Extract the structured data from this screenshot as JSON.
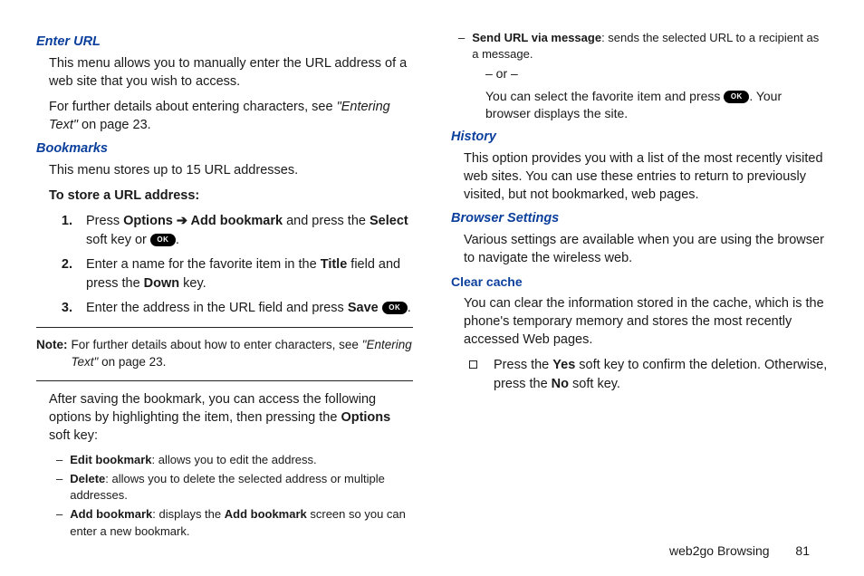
{
  "left": {
    "enter_url_h": "Enter URL",
    "enter_url_p1": "This menu allows you to manually enter the URL address of a web site that you wish to access.",
    "enter_url_p2a": "For further details about entering characters, see ",
    "enter_url_p2b": "\"Entering Text\"",
    "enter_url_p2c": " on page 23.",
    "bookmarks_h": "Bookmarks",
    "bookmarks_p1": "This menu stores up to 15 URL addresses.",
    "to_store": "To store a URL address:",
    "s1n": "1.",
    "s1a": "Press ",
    "s1b": "Options ➔ Add bookmark",
    "s1c": " and press the ",
    "s1d": "Select",
    "s1e": " soft key or ",
    "s1f": ".",
    "s2n": "2.",
    "s2a": "Enter a name for the favorite item in the ",
    "s2b": "Title",
    "s2c": " field and press the ",
    "s2d": "Down",
    "s2e": " key.",
    "s3n": "3.",
    "s3a": "Enter the address in the URL field and press ",
    "s3b": "Save",
    "s3c": " ",
    "s3d": ".",
    "note_l": "Note:",
    "note_a": "For further details about how to enter characters, see ",
    "note_b": "\"Entering Text\"",
    "note_c": " on page 23.",
    "after_a": "After saving the bookmark, you can access the following options by highlighting the item, then pressing the ",
    "after_b": "Options",
    "after_c": " soft key:",
    "d1a": "Edit bookmark",
    "d1b": ": allows you to edit the address.",
    "d2a": "Delete",
    "d2b": ": allows you to delete the selected address or multiple addresses.",
    "d3a": "Add bookmark",
    "d3b": ": displays the ",
    "d3c": "Add bookmark",
    "d3d": " screen so you can enter a new bookmark.",
    "dash": "–"
  },
  "right": {
    "d4a": "Send URL via message",
    "d4b": ": sends the selected URL to a recipient as a message.",
    "or": "– or –",
    "fav_a": "You can select the favorite item and press ",
    "fav_b": ". Your browser displays the site.",
    "history_h": "History",
    "history_p": "This option provides you with a list of the most recently visited web sites. You can use these entries to return to previously visited, but not bookmarked, web pages.",
    "bs_h": "Browser Settings",
    "bs_p": "Various settings are available when you are using the browser to navigate the wireless web.",
    "cc_h": "Clear cache",
    "cc_p": "You can clear the information stored in the cache, which is the phone's temporary memory and stores the most recently accessed Web pages.",
    "b1a": "Press the ",
    "b1b": "Yes",
    "b1c": " soft key to confirm the deletion. Otherwise, press the ",
    "b1d": "No",
    "b1e": " soft key.",
    "dash": "–"
  },
  "ok": "OK",
  "footer_title": "web2go Browsing",
  "footer_pn": "81"
}
